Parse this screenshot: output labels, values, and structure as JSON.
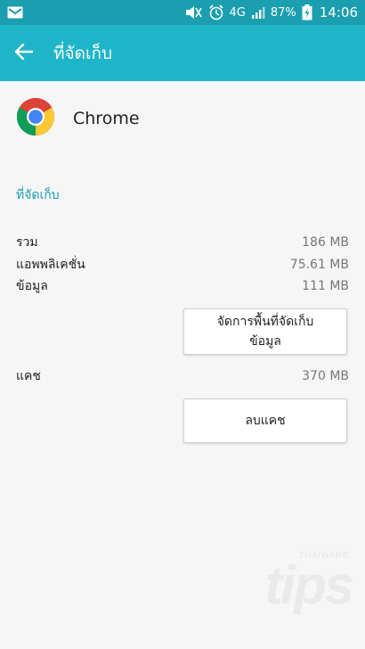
{
  "status_bar": {
    "battery_percent": "87%",
    "network": "4G",
    "time": "14:06",
    "icons": [
      "mail-icon",
      "mute-icon",
      "alarm-icon",
      "signal-icon",
      "battery-charging-icon"
    ]
  },
  "app_bar": {
    "title": "ที่จัดเก็บ",
    "back_icon": "arrow-back-icon"
  },
  "app": {
    "name": "Chrome",
    "icon": "chrome-logo-icon"
  },
  "storage": {
    "section_title": "ที่จัดเก็บ",
    "rows": [
      {
        "label": "รวม",
        "value": "186 MB"
      },
      {
        "label": "แอพพลิเคชั่น",
        "value": "75.61 MB"
      },
      {
        "label": "ข้อมูล",
        "value": "111 MB"
      }
    ],
    "manage_button": {
      "line1": "จัดการพื้นที่จัดเก็บ",
      "line2": "ข้อมูล"
    }
  },
  "cache": {
    "label": "แคช",
    "value": "370 MB",
    "clear_button": "ลบแคช"
  },
  "watermark": {
    "brand": "THAIWARE",
    "text": "tips"
  },
  "colors": {
    "status_bar": "#1a9eb0",
    "app_bar": "#1fb5c8",
    "accent": "#1a9eb0",
    "background": "#f6f6f6"
  }
}
